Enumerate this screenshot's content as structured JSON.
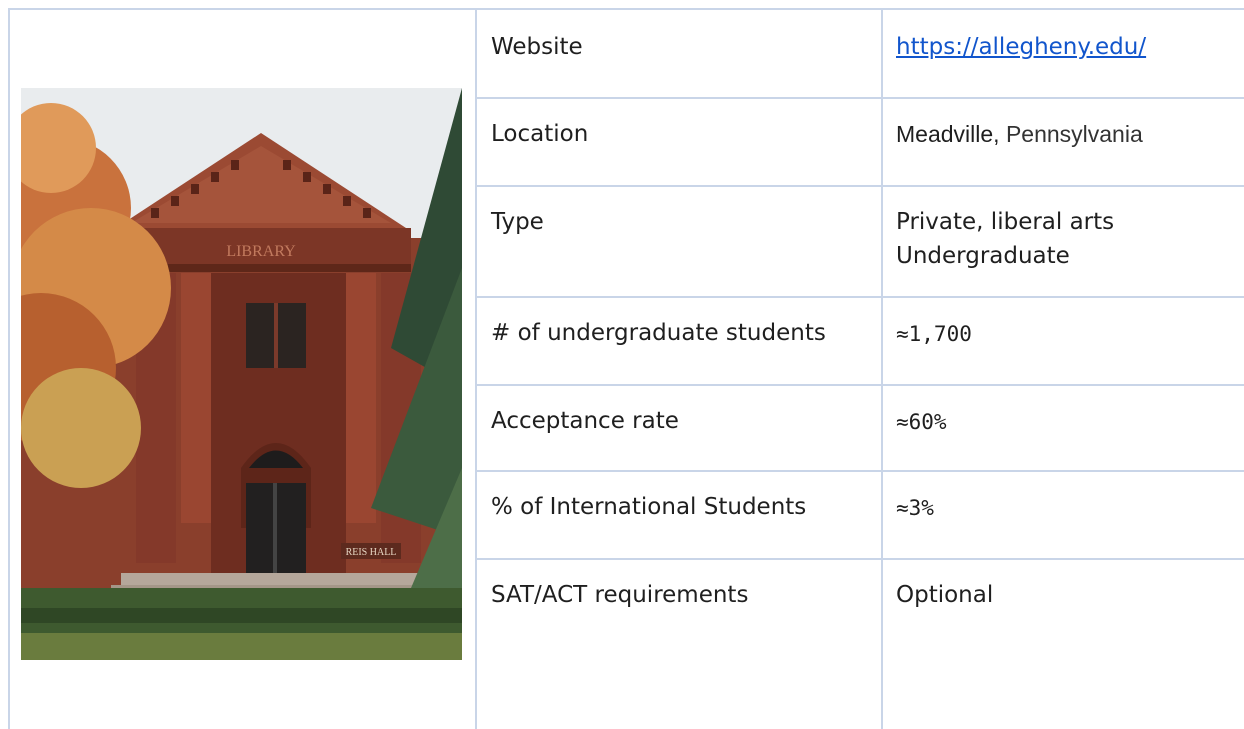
{
  "table": {
    "rows": [
      {
        "label": "Website",
        "value": "https://allegheny.edu/"
      },
      {
        "label": "Location",
        "value_city": "Meadville",
        "value_sep": ",",
        "value_state": "Pennsylvania"
      },
      {
        "label": "Type",
        "value_line1": "Private, liberal arts",
        "value_line2": "Undergraduate"
      },
      {
        "label": "# of undergraduate students",
        "value": "≈1,700"
      },
      {
        "label": "Acceptance rate",
        "value": "≈60%"
      },
      {
        "label": "% of International Students",
        "value": "≈3%"
      },
      {
        "label": "SAT/ACT requirements",
        "value": "Optional"
      }
    ]
  },
  "photo": {
    "sign_text": "REIS HALL",
    "frieze_text": "LIBRARY"
  }
}
